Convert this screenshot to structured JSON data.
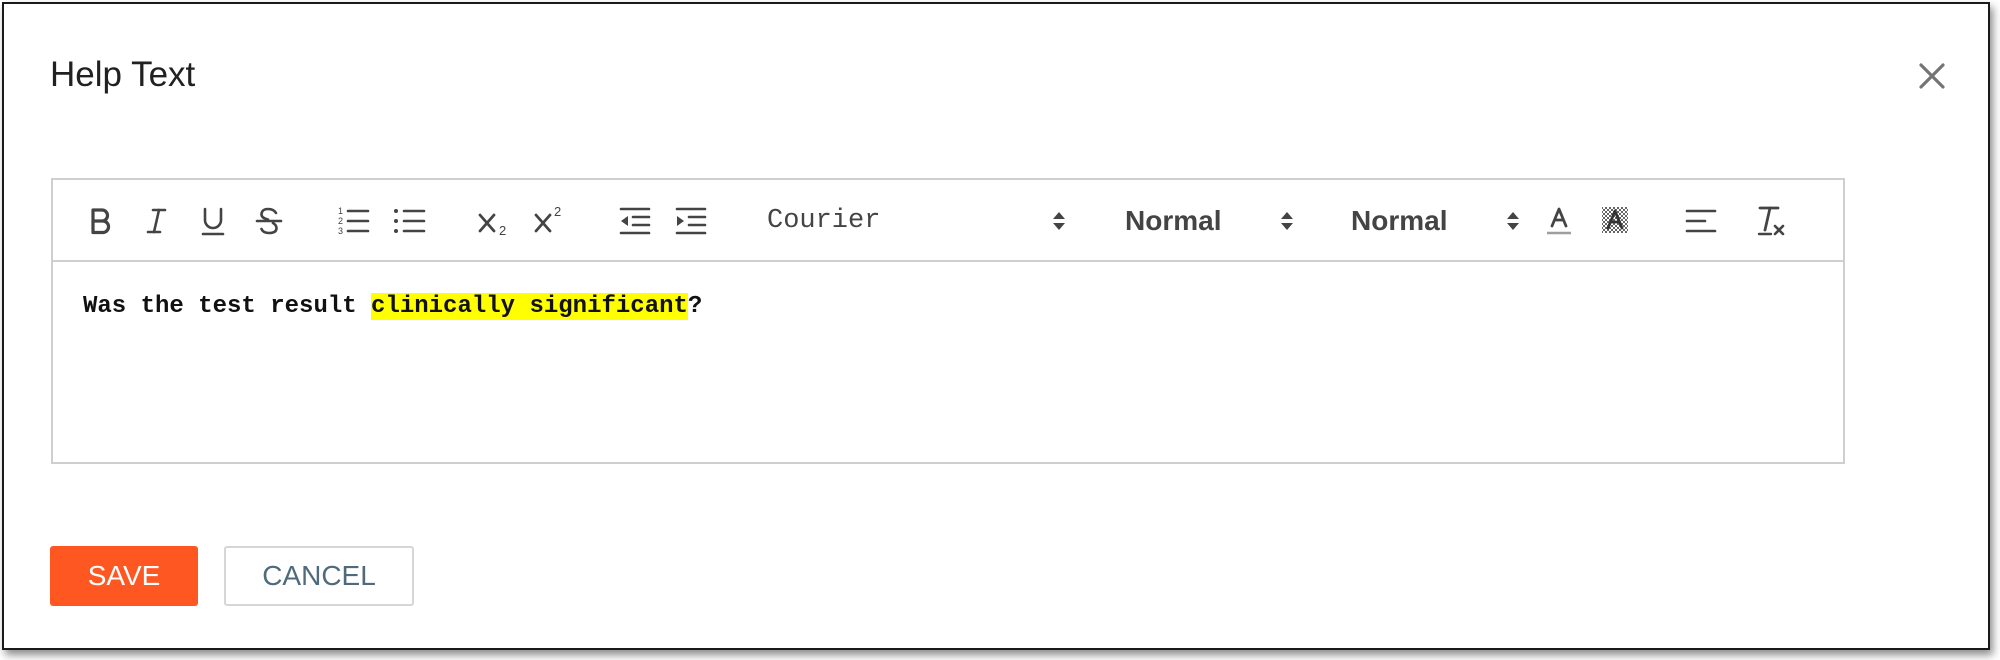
{
  "dialog": {
    "title": "Help Text"
  },
  "toolbar": {
    "font": "Courier",
    "size": "Normal",
    "header": "Normal"
  },
  "editor": {
    "text_before": "Was the test result ",
    "text_highlighted": "clinically significant",
    "text_after": "?"
  },
  "colors": {
    "accent": "#ff5722",
    "highlight": "#ffff00",
    "cancel_text": "#4f6b7b"
  },
  "icons": [
    "bold-icon",
    "italic-icon",
    "underline-icon",
    "strikethrough-icon",
    "ordered-list-icon",
    "bullet-list-icon",
    "subscript-icon",
    "superscript-icon",
    "outdent-icon",
    "indent-icon",
    "text-color-icon",
    "background-color-icon",
    "align-left-icon",
    "clear-format-icon",
    "close-icon"
  ],
  "actions": {
    "save": "Save",
    "cancel": "Cancel"
  }
}
